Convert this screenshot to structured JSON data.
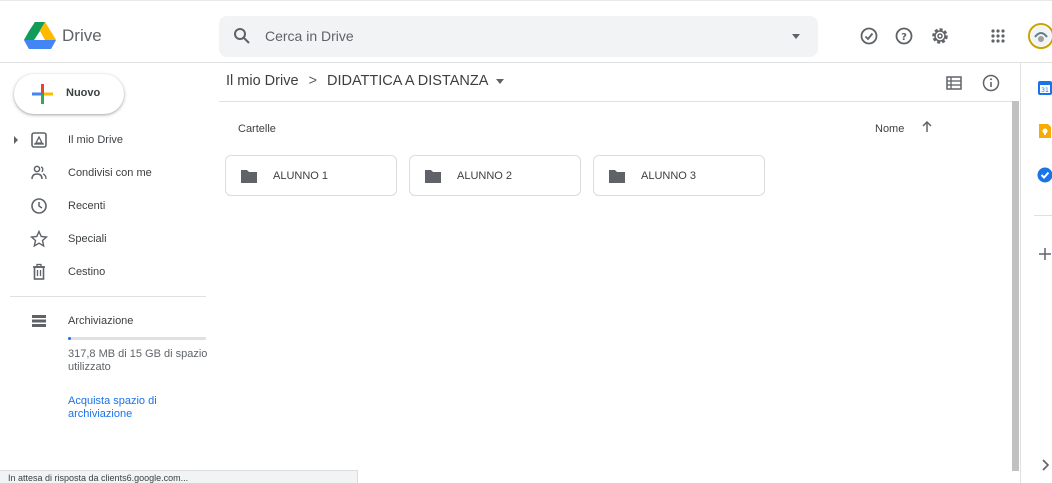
{
  "header": {
    "brand": "Drive",
    "search_placeholder": "Cerca in Drive"
  },
  "sidebar": {
    "new_label": "Nuovo",
    "items": [
      {
        "label": "Il mio Drive",
        "icon": "my-drive-icon"
      },
      {
        "label": "Condivisi con me",
        "icon": "shared-icon"
      },
      {
        "label": "Recenti",
        "icon": "clock-icon"
      },
      {
        "label": "Speciali",
        "icon": "star-icon"
      },
      {
        "label": "Cestino",
        "icon": "trash-icon"
      }
    ],
    "storage": {
      "label": "Archiviazione",
      "usage_text": "317,8 MB di 15 GB di spazio utilizzato",
      "usage_fraction": 0.021,
      "buy_link": "Acquista spazio di archiviazione"
    }
  },
  "main": {
    "breadcrumb": {
      "root": "Il mio Drive",
      "separator": ">",
      "current": "DIDATTICA A DISTANZA"
    },
    "section_title": "Cartelle",
    "sort_label": "Nome",
    "folders": [
      {
        "name": "ALUNNO 1"
      },
      {
        "name": "ALUNNO 2"
      },
      {
        "name": "ALUNNO 3"
      }
    ]
  },
  "status_bar": "In attesa di risposta da clients6.google.com...",
  "colors": {
    "accent": "#1a73e8",
    "folder_icon": "#5f6368",
    "calendar": "#1a73e8",
    "keep": "#f9ab00",
    "tasks": "#1a73e8"
  }
}
